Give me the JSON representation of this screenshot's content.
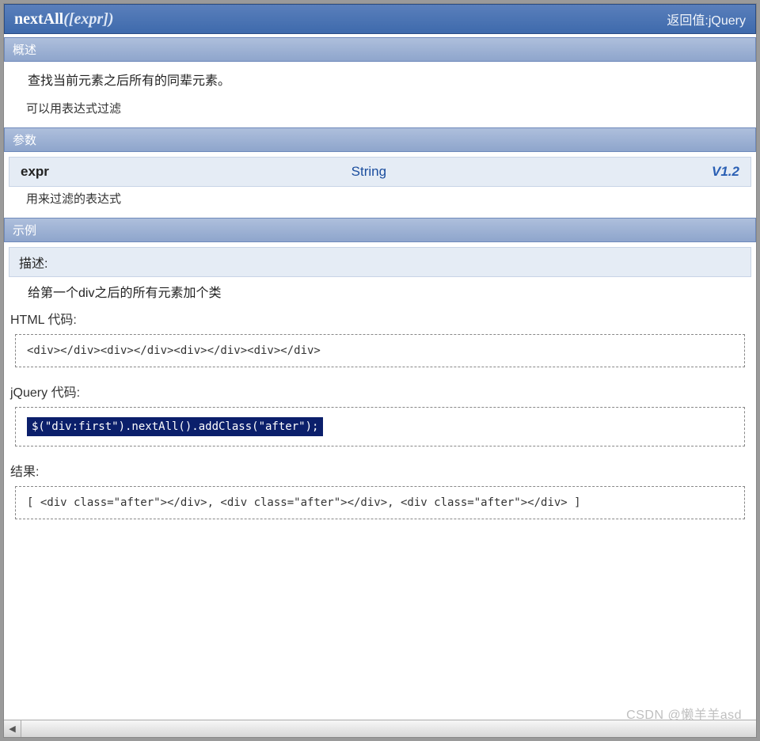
{
  "header": {
    "method": "nextAll",
    "args": "([expr])",
    "return_label": "返回值:",
    "return_type": "jQuery"
  },
  "sections": {
    "overview_title": "概述",
    "overview_main": "查找当前元素之后所有的同辈元素。",
    "overview_note": "可以用表达式过滤",
    "params_title": "参数",
    "param": {
      "name": "expr",
      "type": "String",
      "version": "V1.2",
      "desc": "用来过滤的表达式"
    },
    "example_title": "示例",
    "example_desc_label": "描述:",
    "example_desc": "给第一个div之后的所有元素加个类",
    "html_label": "HTML 代码:",
    "html_code": "<div></div><div></div><div></div><div></div>",
    "jquery_label": "jQuery 代码:",
    "jquery_code": "$(\"div:first\").nextAll().addClass(\"after\");",
    "result_label": "结果:",
    "result_code": "[ <div class=\"after\"></div>, <div class=\"after\"></div>, <div class=\"after\"></div> ]"
  },
  "watermark": "CSDN @懒羊羊asd",
  "scroll_glyph": "◀"
}
